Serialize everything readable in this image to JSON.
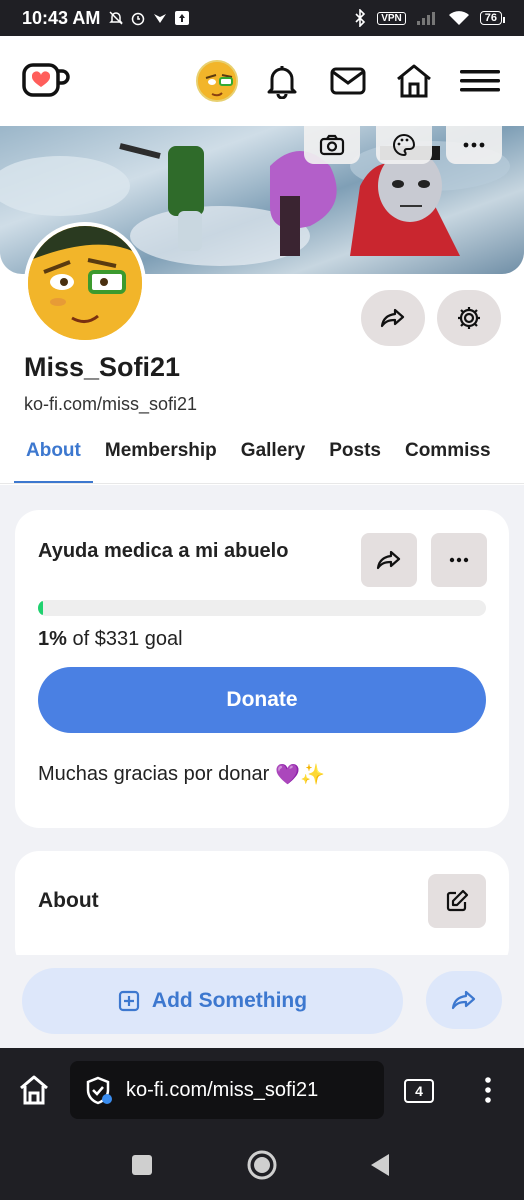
{
  "status_bar": {
    "time": "10:43 AM",
    "vpn": "VPN",
    "battery": "76"
  },
  "header": {
    "icons": [
      "kofi-cup-icon",
      "avatar",
      "bell-icon",
      "mail-icon",
      "home-icon",
      "menu-icon"
    ]
  },
  "profile": {
    "name": "Miss_Sofi21",
    "url": "ko-fi.com/miss_sofi21"
  },
  "tabs": [
    {
      "label": "About",
      "active": true
    },
    {
      "label": "Membership",
      "active": false
    },
    {
      "label": "Gallery",
      "active": false
    },
    {
      "label": "Posts",
      "active": false
    },
    {
      "label": "Commiss",
      "active": false
    }
  ],
  "goal": {
    "title": "Ayuda medica a mi abuelo",
    "percent_text": "1%",
    "of_text": "of $331 goal",
    "progress_fraction": 0.01,
    "donate_label": "Donate",
    "thanks": "Muchas gracias por donar",
    "emojis": "💜✨"
  },
  "about": {
    "title": "About"
  },
  "actions": {
    "add_label": "Add Something"
  },
  "browser": {
    "url": "ko-fi.com/miss_sofi21",
    "tab_count": "4"
  },
  "colors": {
    "accent": "#4a80e3",
    "tab_active": "#3d78cf",
    "progress": "#1fd16f",
    "kofi_red": "#ff5e5b"
  }
}
